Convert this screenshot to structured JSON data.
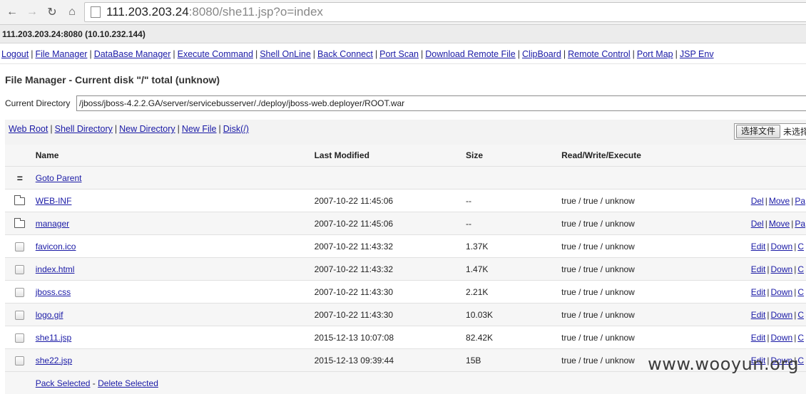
{
  "browser": {
    "url_host": "111.203.203.24",
    "url_rest": ":8080/she11.jsp?o=index"
  },
  "host_info": "111.203.203.24:8080 (10.10.232.144)",
  "menu": [
    "Logout",
    "File Manager",
    "DataBase Manager",
    "Execute Command",
    "Shell OnLine",
    "Back Connect",
    "Port Scan",
    "Download Remote File",
    "ClipBoard",
    "Remote Control",
    "Port Map",
    "JSP Env"
  ],
  "file_manager": {
    "title": "File Manager - Current disk \"/\" total (unknow)",
    "current_dir_label": "Current Directory",
    "current_dir_value": "/jboss/jboss-4.2.2.GA/server/servicebusserver/./deploy/jboss-web.deployer/ROOT.war",
    "quick_links": [
      "Web Root",
      "Shell Directory",
      "New Directory",
      "New File",
      "Disk(/)"
    ],
    "upload_button": "选择文件",
    "upload_status": "未选择",
    "columns": {
      "name": "Name",
      "modified": "Last Modified",
      "size": "Size",
      "rwx": "Read/Write/Execute"
    },
    "parent": {
      "icon": "=",
      "label": "Goto Parent"
    },
    "rows": [
      {
        "type": "folder",
        "name": "WEB-INF",
        "modified": "2007-10-22 11:45:06",
        "size": "--",
        "rwx": "true / true / unknow",
        "actions": [
          "Del",
          "Move",
          "Pa"
        ]
      },
      {
        "type": "folder",
        "name": "manager",
        "modified": "2007-10-22 11:45:06",
        "size": "--",
        "rwx": "true / true / unknow",
        "actions": [
          "Del",
          "Move",
          "Pa"
        ]
      },
      {
        "type": "file",
        "name": "favicon.ico",
        "modified": "2007-10-22 11:43:32",
        "size": "1.37K",
        "rwx": "true / true / unknow",
        "actions": [
          "Edit",
          "Down",
          "C"
        ]
      },
      {
        "type": "file",
        "name": "index.html",
        "modified": "2007-10-22 11:43:32",
        "size": "1.47K",
        "rwx": "true / true / unknow",
        "actions": [
          "Edit",
          "Down",
          "C"
        ]
      },
      {
        "type": "file",
        "name": "jboss.css",
        "modified": "2007-10-22 11:43:30",
        "size": "2.21K",
        "rwx": "true / true / unknow",
        "actions": [
          "Edit",
          "Down",
          "C"
        ]
      },
      {
        "type": "file",
        "name": "logo.gif",
        "modified": "2007-10-22 11:43:30",
        "size": "10.03K",
        "rwx": "true / true / unknow",
        "actions": [
          "Edit",
          "Down",
          "C"
        ]
      },
      {
        "type": "file",
        "name": "she11.jsp",
        "modified": "2015-12-13 10:07:08",
        "size": "82.42K",
        "rwx": "true / true / unknow",
        "actions": [
          "Edit",
          "Down",
          "C"
        ]
      },
      {
        "type": "file",
        "name": "she22.jsp",
        "modified": "2015-12-13 09:39:44",
        "size": "15B",
        "rwx": "true / true / unknow",
        "actions": [
          "Edit",
          "Down",
          "C"
        ]
      }
    ],
    "footer_actions": [
      "Pack Selected",
      "Delete Selected"
    ]
  },
  "watermark": "www.wooyun.org"
}
